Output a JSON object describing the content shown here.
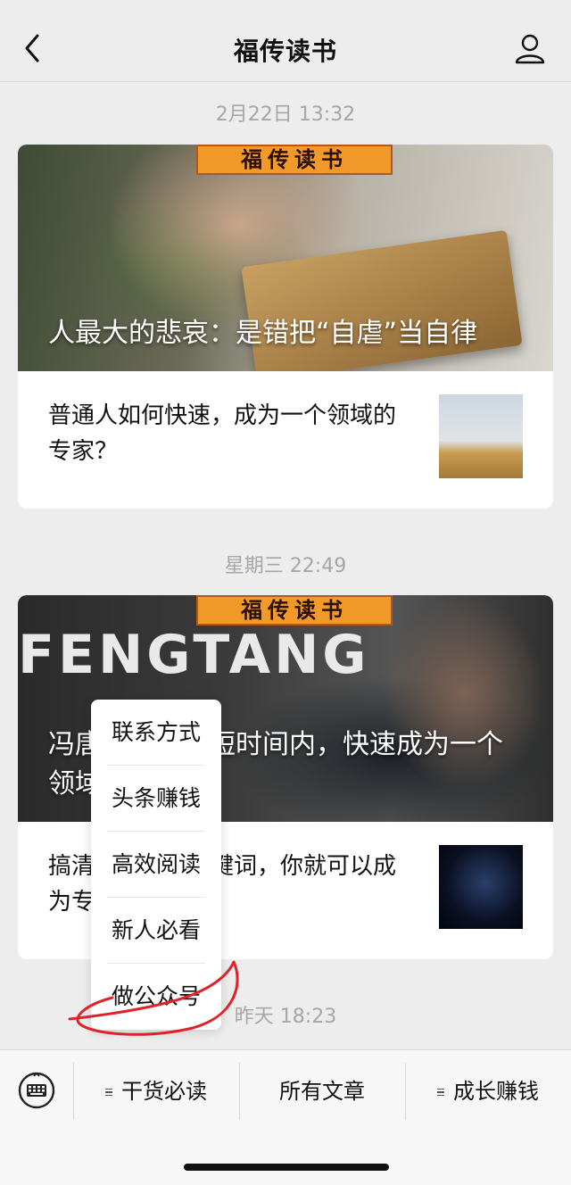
{
  "header": {
    "title": "福传读书"
  },
  "feed": [
    {
      "timestamp": "2月22日 13:32",
      "brand": "福传读书",
      "cover_title": "人最大的悲哀：是错把“自虐”当自律",
      "sub_title": "普通人如何快速，成为一个领域的专家？"
    },
    {
      "timestamp": "星期三 22:49",
      "brand": "福传读书",
      "cover_overlay_text": "FENGTANG",
      "cover_title": "冯唐：如何在短时间内，快速成为一个领域的专家？",
      "sub_title": "搞清楚这几个关键词，你就可以成为专家"
    },
    {
      "timestamp": "昨天 18:23"
    }
  ],
  "popup_menu": {
    "items": [
      "联系方式",
      "头条赚钱",
      "高效阅读",
      "新人必看",
      "做公众号"
    ]
  },
  "menubar": {
    "tabs": [
      "干货必读",
      "所有文章",
      "成长赚钱"
    ]
  },
  "colors": {
    "annotation": "#e0222a",
    "banner": "#f19a2a"
  }
}
